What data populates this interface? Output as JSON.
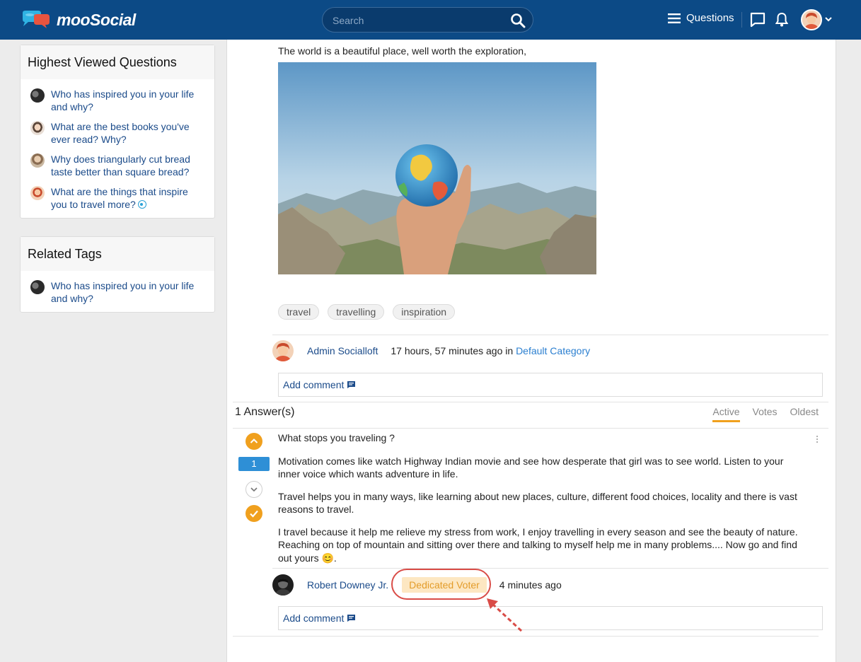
{
  "header": {
    "logo_text": "mooSocial",
    "search_placeholder": "Search",
    "nav_questions_label": "Questions"
  },
  "sidebar": {
    "highest_viewed": {
      "title": "Highest Viewed Questions",
      "items": [
        {
          "label": "Who has inspired you in your life and why?"
        },
        {
          "label": "What are the best books you've ever read? Why?"
        },
        {
          "label": "Why does triangularly cut bread taste better than square bread?"
        },
        {
          "label": "What are the things that inspire you to travel more?"
        }
      ]
    },
    "related_tags": {
      "title": "Related Tags",
      "items": [
        {
          "label": "Who has inspired you in your life and why?"
        }
      ]
    }
  },
  "question": {
    "intro_text": "The world is a beautiful place, well worth the exploration,",
    "tags": [
      "travel",
      "travelling",
      "inspiration"
    ],
    "author": "Admin Socialloft",
    "time": "17 hours, 57 minutes ago in",
    "category": "Default Category",
    "add_comment": "Add comment"
  },
  "answers": {
    "heading": "1 Answer(s)",
    "sort_tabs": [
      "Active",
      "Votes",
      "Oldest"
    ],
    "active_tab": "Active",
    "vote_count": "1",
    "answer_title": "What stops you traveling ?",
    "paragraphs": [
      "Motivation comes like watch Highway Indian movie and see how desperate that girl was to see world. Listen to your inner voice which wants adventure in life.",
      "Travel helps you in many ways, like learning about new places, culture, different food choices, locality and there is vast reasons to travel.",
      "I travel because it help me relieve my stress from work, I enjoy travelling in every season and see the beauty of nature. Reaching on top of mountain and sitting over there and talking to myself help me in many problems.... Now go and find out yours 😊."
    ],
    "author": "Robert Downey Jr.",
    "badge": "Dedicated Voter",
    "time": "4 minutes ago",
    "add_comment": "Add comment"
  },
  "colors": {
    "header_bg": "#0c4a86",
    "accent_orange": "#f0a01e",
    "vote_blue": "#2e8fd6",
    "link_blue": "#1b4b8a",
    "badge_bg": "#fde7c2",
    "highlight_red": "#d94c47"
  }
}
